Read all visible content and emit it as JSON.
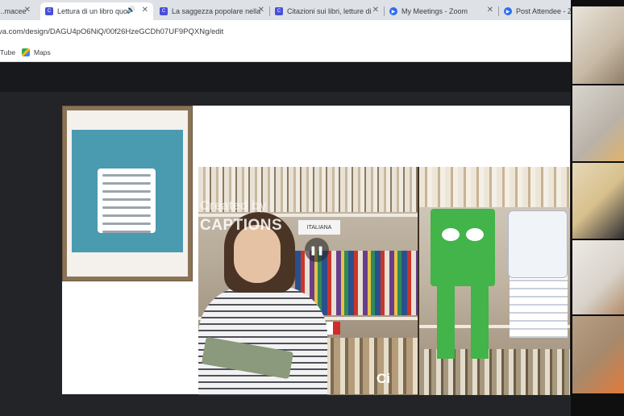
{
  "browser": {
    "tabs": [
      {
        "title": "...macee",
        "icon": "canva-icon",
        "active": false
      },
      {
        "title": "Lettura di un libro quo",
        "icon": "canva-icon",
        "active": true,
        "audio": true
      },
      {
        "title": "La saggezza popolare nella",
        "icon": "canva-icon",
        "active": false
      },
      {
        "title": "Citazioni sui libri, letture di",
        "icon": "canva-icon",
        "active": false
      },
      {
        "title": "My Meetings - Zoom",
        "icon": "zoom-icon",
        "active": false
      },
      {
        "title": "Post Attendee - Zo",
        "icon": "zoom-icon",
        "active": false
      }
    ],
    "url": "va.com/design/DAGU4pO6NiQ/00f26HzeGCDh07UF9PQXNg/edit",
    "bookmarks": {
      "youtube": "Tube",
      "maps": "Maps"
    }
  },
  "video": {
    "watermark_line1": "Created by",
    "watermark_line2": "CAPTIONS",
    "label_text": "ITALIANA",
    "pause_glyph": "❚❚",
    "logo_text": "Ci"
  },
  "colors": {
    "canvas_bg": "#232428",
    "tab_bar": "#dee1e6",
    "robot_green": "#42b449"
  }
}
